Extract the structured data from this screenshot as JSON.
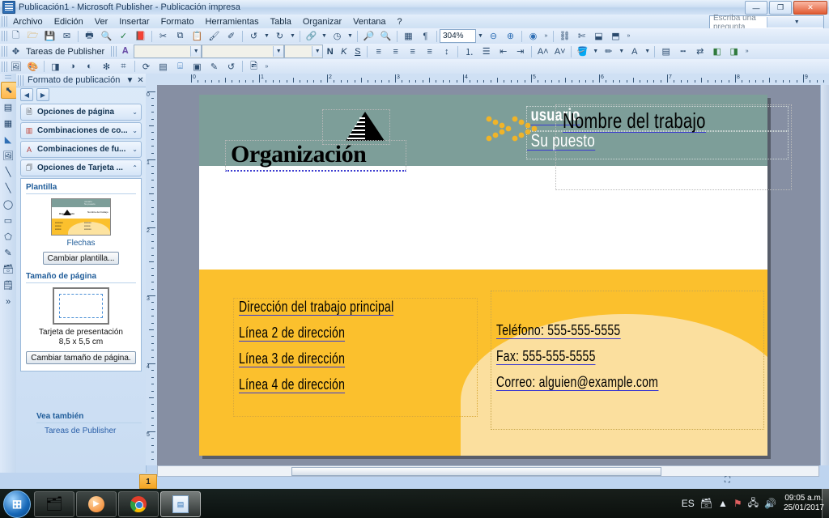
{
  "window": {
    "title": "Publicación1 - Microsoft Publisher -  Publicación impresa",
    "minimize": "—",
    "maximize": "❐",
    "close": "✕"
  },
  "menu": {
    "items": [
      "Archivo",
      "Edición",
      "Ver",
      "Insertar",
      "Formato",
      "Herramientas",
      "Tabla",
      "Organizar",
      "Ventana",
      "?"
    ]
  },
  "ask": {
    "placeholder": "Escriba una pregunta",
    "text": "Escriba una pregunta"
  },
  "toolbars": {
    "standard": [
      "new-icon",
      "open-icon",
      "save-icon",
      "email-icon",
      "print-icon",
      "print-preview-icon",
      "spelling-icon",
      "research-icon",
      "cut-icon",
      "copy-icon",
      "paste-icon",
      "format-painter-icon",
      "undo-icon",
      "redo-icon",
      "hyperlink-icon",
      "design-gallery-icon",
      "special-characters-icon",
      "show-paragraph-icon"
    ],
    "zoom_value": "304%",
    "zoom_out": "zoom-out-icon",
    "zoom_in": "zoom-in-icon",
    "help": "help-icon",
    "publisher_tasks_label": "Tareas de Publisher",
    "font_name": "",
    "font_size": "",
    "style_box": "",
    "bold": "N",
    "italic": "K",
    "underline": "S",
    "formatting": [
      "align-left-icon",
      "align-center-icon",
      "align-right-icon",
      "justify-icon",
      "line-spacing-icon",
      "numbered-list-icon",
      "bulleted-list-icon",
      "decrease-indent-icon",
      "increase-indent-icon",
      "grow-font-icon",
      "shrink-font-icon",
      "fill-color-icon",
      "line-color-icon",
      "font-color-icon",
      "line-style-icon",
      "dash-style-icon",
      "line-arrow-icon",
      "shadow-icon",
      "3d-icon"
    ],
    "picture_row": [
      "insert-picture-icon",
      "color-icon",
      "crop-icon",
      "more-contrast-icon",
      "less-contrast-icon",
      "more-brightness-icon",
      "less-brightness-icon",
      "rotate-icon",
      "line-weight-icon",
      "text-wrap-icon",
      "set-transparent-icon",
      "format-picture-icon",
      "reset-picture-icon",
      "recolor-icon"
    ]
  },
  "objects_toolbar": {
    "items": [
      "select-objects-icon",
      "text-box-icon",
      "insert-table-icon",
      "wordart-icon",
      "picture-frame-icon",
      "line-icon",
      "arrow-icon",
      "oval-icon",
      "rectangle-icon",
      "autoshapes-icon",
      "design-gallery-object-icon",
      "item-from-content-library-icon",
      "business-form-icon"
    ],
    "selected": "select-objects-icon"
  },
  "task_pane": {
    "title": "Formato de publicación",
    "close": "✕",
    "dropdown": "▼",
    "nav_back": "◀",
    "nav_forward": "▶",
    "accordions": [
      {
        "label": "Opciones de página",
        "icon": "page-options-icon",
        "chevron": "⌄"
      },
      {
        "label": "Combinaciones de co...",
        "icon": "color-schemes-icon",
        "chevron": "⌄"
      },
      {
        "label": "Combinaciones de fu...",
        "icon": "font-schemes-icon",
        "chevron": "⌄"
      },
      {
        "label": "Opciones de Tarjeta ...",
        "icon": "card-options-icon",
        "chevron": "⌃"
      }
    ],
    "template_section": "Plantilla",
    "template_name": "Flechas",
    "change_template_button": "Cambiar plantilla...",
    "page_size_section": "Tamaño de página",
    "page_size_name": "Tarjeta de presentación",
    "page_size_dims": "8,5 x 5,5 cm",
    "change_page_size_button": "Cambiar tamaño de página.",
    "see_also_label": "Vea también",
    "see_also_link": "Tareas de Publisher",
    "thumb_texts": {
      "name": "usuario",
      "post": "Su puesto",
      "org": "Organización",
      "job": "Nombre del trabajo"
    }
  },
  "rulers": {
    "horizontal_labels": [
      "0",
      "1",
      "2",
      "3",
      "4",
      "5",
      "6",
      "7",
      "8",
      "9"
    ],
    "vertical_labels": [
      "0",
      "1",
      "2",
      "3",
      "4",
      "5"
    ],
    "unit": "cm"
  },
  "card": {
    "name": "usuario",
    "job_position": "Su puesto",
    "organization": "Organización",
    "job_name": "Nombre del trabajo",
    "address_lines": [
      "Dirección del trabajo principal",
      "Línea 2 de dirección",
      "Línea 3 de dirección",
      "Línea 4 de dirección"
    ],
    "contact_lines": [
      "Teléfono: 555-555-5555",
      "Fax: 555-555-5555",
      "Correo: alguien@example.com"
    ],
    "colors": {
      "band": "#7d9e99",
      "body": "#fbc02d",
      "dome": "#fbdf9e",
      "accent_dot": "#f0b429",
      "white": "#ffffff"
    }
  },
  "status": {
    "page_number": "1",
    "position_icon": "object-position-icon"
  },
  "taskbar": {
    "start": "start-orb-icon",
    "buttons": [
      {
        "name": "windows-explorer-icon",
        "glyph": "🗂",
        "active": false
      },
      {
        "name": "windows-media-player-icon",
        "glyph": "▶",
        "active": false
      },
      {
        "name": "google-chrome-icon",
        "glyph": "◉",
        "active": false
      },
      {
        "name": "microsoft-publisher-icon",
        "glyph": "📄",
        "active": true
      }
    ],
    "tray": {
      "language": "ES",
      "icons": [
        "hidden-icons-icon",
        "network-icon",
        "action-center-icon",
        "volume-icon"
      ],
      "time": "09:05 a.m.",
      "date": "25/01/2017"
    }
  }
}
